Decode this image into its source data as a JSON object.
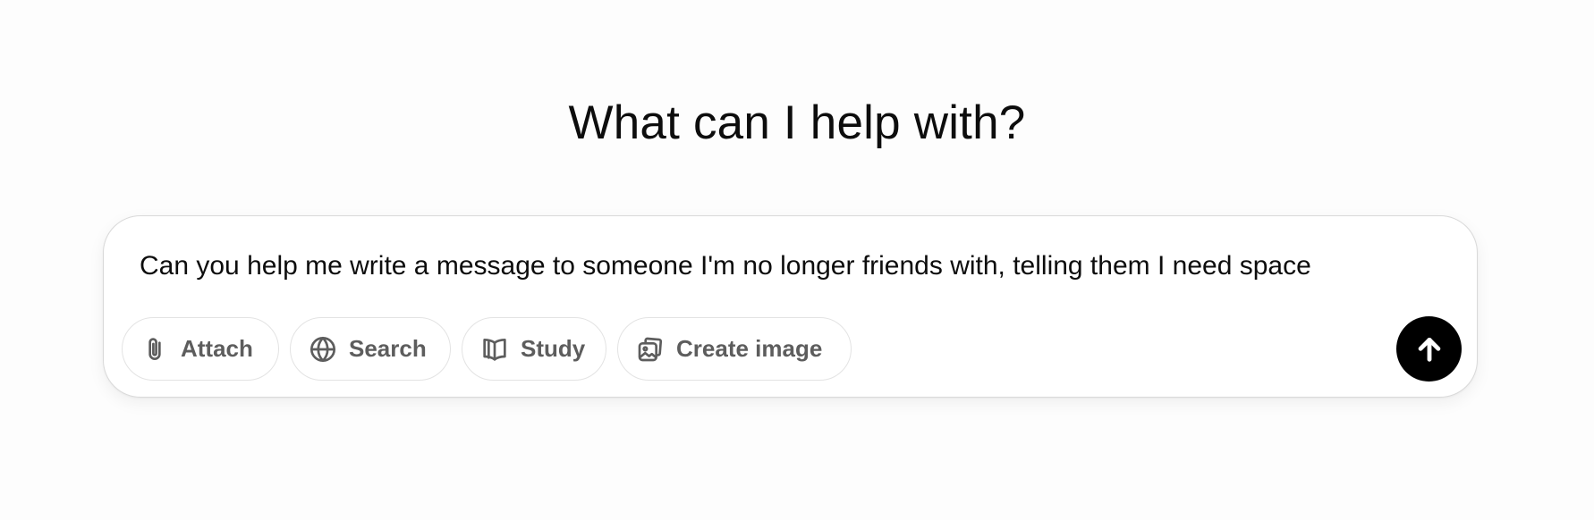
{
  "heading": "What can I help with?",
  "composer": {
    "input_value": "Can you help me write a message to someone I'm no longer friends with, telling them I need space",
    "tools": {
      "attach": {
        "label": "Attach",
        "icon": "paperclip-icon"
      },
      "search": {
        "label": "Search",
        "icon": "globe-icon"
      },
      "study": {
        "label": "Study",
        "icon": "open-book-icon"
      },
      "create_image": {
        "label": "Create image",
        "icon": "image-icon"
      }
    },
    "send": {
      "icon": "arrow-up-icon",
      "color": "#000000"
    }
  },
  "colors": {
    "background": "#fdfdfd",
    "text": "#0d0d0d",
    "muted": "#5d5d5d",
    "border": "#d9d9d9"
  }
}
